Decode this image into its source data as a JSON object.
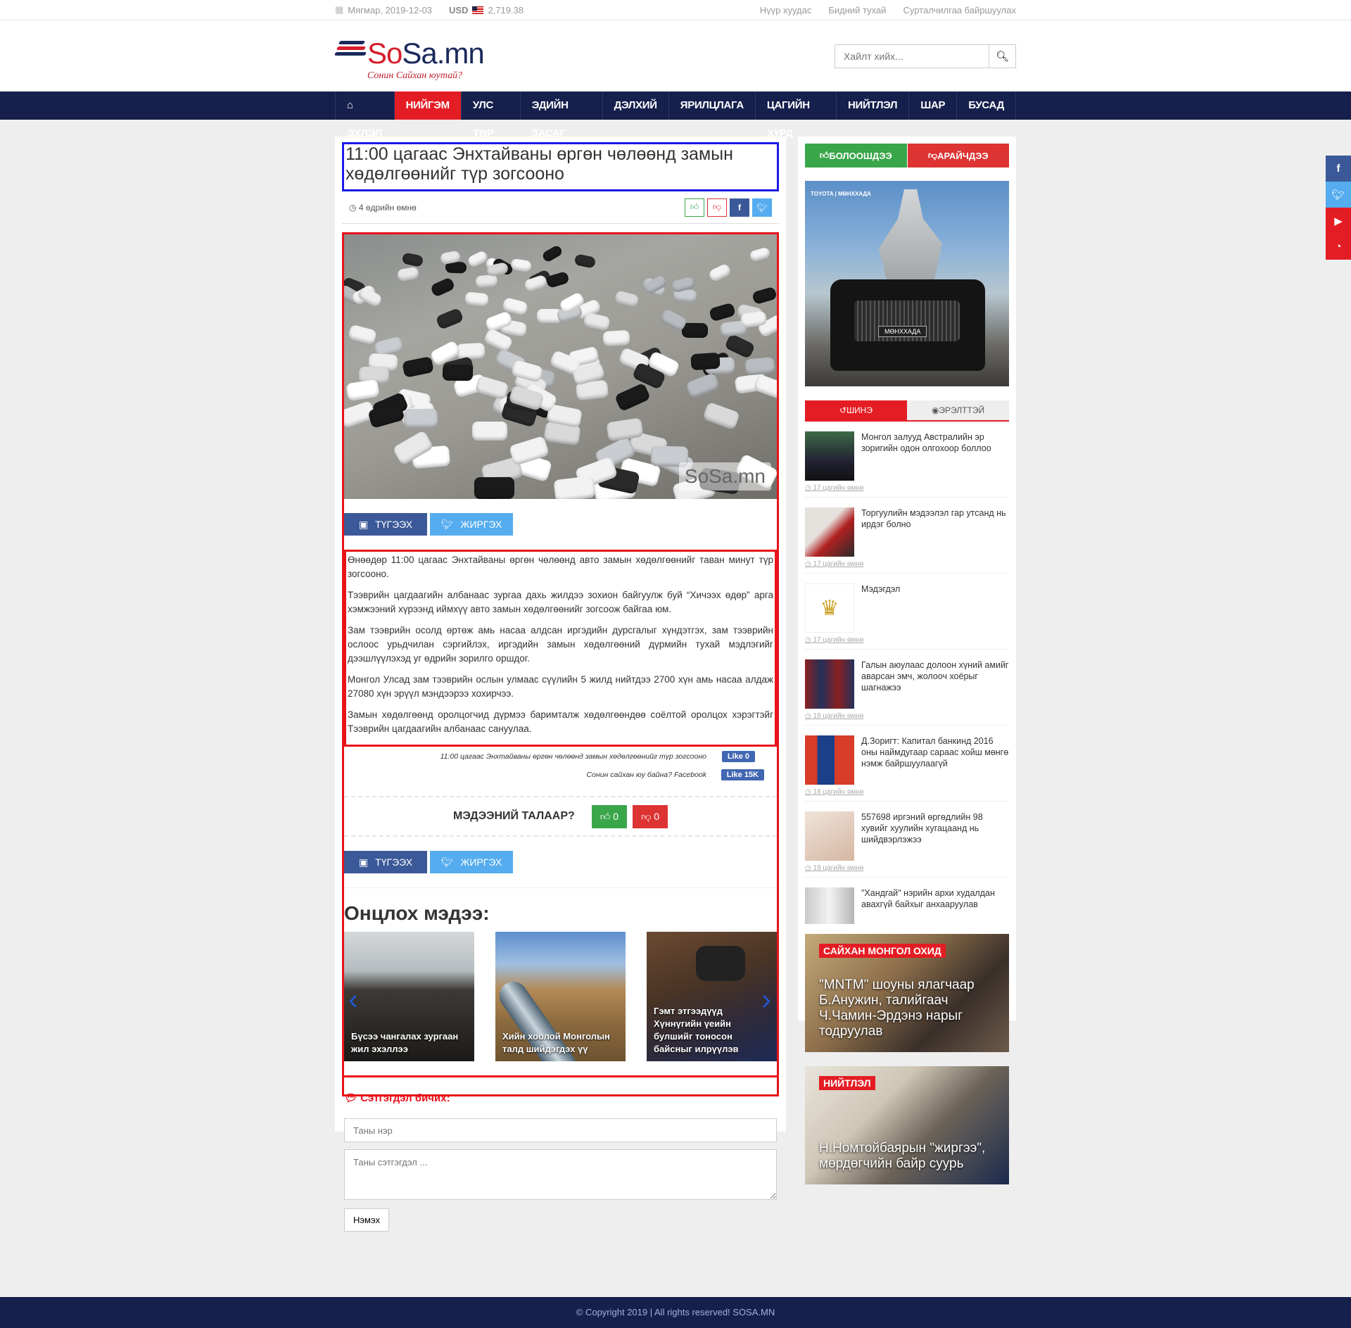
{
  "topbar": {
    "date": "Мягмар, 2019-12-03",
    "currency": "USD",
    "rate": "2,719.38",
    "links": [
      "Нүүр хуудас",
      "Бидний тухай",
      "Сурталчилгаа байршуулах"
    ]
  },
  "logo": {
    "so1": "So",
    "sa": "Sa",
    "mn": ".mn",
    "tagline": "Сонин Сайхан юутай?"
  },
  "search": {
    "placeholder": "Хайлт хийх..."
  },
  "nav": [
    "ЭХЛЭЛ",
    "НИЙГЭМ",
    "УЛС ТӨР",
    "ЭДИЙН ЗАСАГ",
    "ДЭЛХИЙ",
    "ЯРИЛЦЛАГА",
    "ЦАГИЙН ХҮРД",
    "НИЙТЛЭЛ",
    "ШАР",
    "БУСАД"
  ],
  "article": {
    "title": "11:00 цагаас Энхтайваны өргөн чөлөөнд замын хөдөлгөөнийг түр зогсооно",
    "time": "4 өдрийн өмнө",
    "watermark": "SoSa.mn",
    "share_fb": "ТҮГЭЭХ",
    "share_tw": "ЖИРГЭХ",
    "paragraphs": [
      "Өнөөдөр 11:00 цагаас Энхтайваны өргөн чөлөөнд авто замын хөдөлгөөнийг таван минут түр зогсооно.",
      "Тээврийн цагдаагийн албанаас зургаа дахь жилдээ зохион байгуулж буй “Хичээх өдөр” арга хэмжээний хүрээнд иймхүү авто замын хөдөлгөөнийг зогсоож байгаа юм.",
      "Зам тээврийн осолд өртөж амь насаа алдсан иргэдийн дурсгалыг хүндэтгэх, зам тээврийн ослоос урьдчилан сэргийлэх, иргэдийн замын хөдөлгөөний дүрмийн тухай мэдлэгийг дээшлүүлэхэд уг өдрийн зорилго оршдог.",
      "Монгол Улсад зам тээврийн ослын улмаас сүүлийн 5 жилд нийтдээ 2700 хүн амь насаа алдаж 27080 хүн эрүүл мэндээрээ хохирчээ.",
      "Замын хөдөлгөөнд оролцогчид дүрмээ баримталж хөдөлгөөндөө соёлтой оролцох хэрэгтэйг Тээврийн цагдаагийн албанаас сануулаа."
    ],
    "fb_line1": "11:00 цагаас Энхтайваны өргөн чөлөөнд замын хөдөлгөөнийг түр зогсооно",
    "fb_like1": "Like 0",
    "fb_line2": "Сонин сайхан юу байна? Facebook",
    "fb_like2": "Like 15K",
    "vote_question": "МЭДЭЭНИЙ ТАЛААР?",
    "vote_up": "0",
    "vote_down": "0"
  },
  "featured": {
    "heading": "Онцлох мэдээ:",
    "items": [
      {
        "title": "Бүсээ чангалах зургаан жил эхэллээ"
      },
      {
        "title": "Хийн хоолой Монголын талд шийдэгдэх үү"
      },
      {
        "title": "Гэмт этгээдүүд Хүннүгийн үеийн булшийг тоносон байсныг илрүүлэв"
      }
    ]
  },
  "comment": {
    "heading": "Сэтгэгдэл бичих:",
    "name_placeholder": "Таны нэр",
    "text_placeholder": "Таны сэтгэгдэл ...",
    "submit": "Нэмэх"
  },
  "sidebar": {
    "vote_good": "БОЛООШДЭЭ",
    "vote_bad": "АРАЙЧДЭЭ",
    "ad": {
      "brand": "TOYOTA | МӨНХХАДА",
      "badge": "МӨНХХАДА"
    },
    "tab_new": "ШИНЭ",
    "tab_popular": "ЭРЭЛТТЭЙ",
    "news": [
      {
        "title": "Монгол залууд Австралийн эр зоригийн одон олгохоор боллоо",
        "time": "17 цагийн өмнө"
      },
      {
        "title": "Торгуулийн мэдээлэл гар утсанд нь ирдэг болно",
        "time": "17 цагийн өмнө"
      },
      {
        "title": "Мэдэгдэл",
        "time": "17 цагийн өмнө"
      },
      {
        "title": "Галын аюулаас долоон хүний амийг аварсан эмч, жолооч хоёрыг шагнажээ",
        "time": "18 цагийн өмнө"
      },
      {
        "title": "Д.Зоригт: Капитал банкинд 2016 оны наймдугаар сараас хойш мөнгө нэмж байршуулаагүй",
        "time": "18 цагийн өмнө"
      },
      {
        "title": "557698 иргэний өргөдлийн 98 хувийг хуулийн хугацаанд нь шийдвэрлэжээ",
        "time": "19 цагийн өмнө"
      },
      {
        "title": "\"Хандгай\" нэрийн архи худалдан авахгүй байхыг анхааруулав",
        "time": ""
      }
    ],
    "promo1": {
      "tag": "САЙХАН МОНГОЛ ОХИД",
      "caption": "\"MNTM\" шоуны ялагчаар Б.Анужин, талийгаач Ч.Чамин-Эрдэнэ нарыг тодруулав"
    },
    "promo2": {
      "tag": "НИЙТЛЭЛ",
      "caption": "Н.Номтойбаярын \"жиргээ\", мөрдөгчийн байр суурь"
    }
  },
  "footer": {
    "text": "© Copyright 2019 | All rights reserved! SOSA.MN"
  },
  "colors": {
    "navy": "#16204d",
    "red": "#e41c23",
    "green": "#3aa64a",
    "facebook": "#3b5998",
    "twitter": "#55acee"
  }
}
